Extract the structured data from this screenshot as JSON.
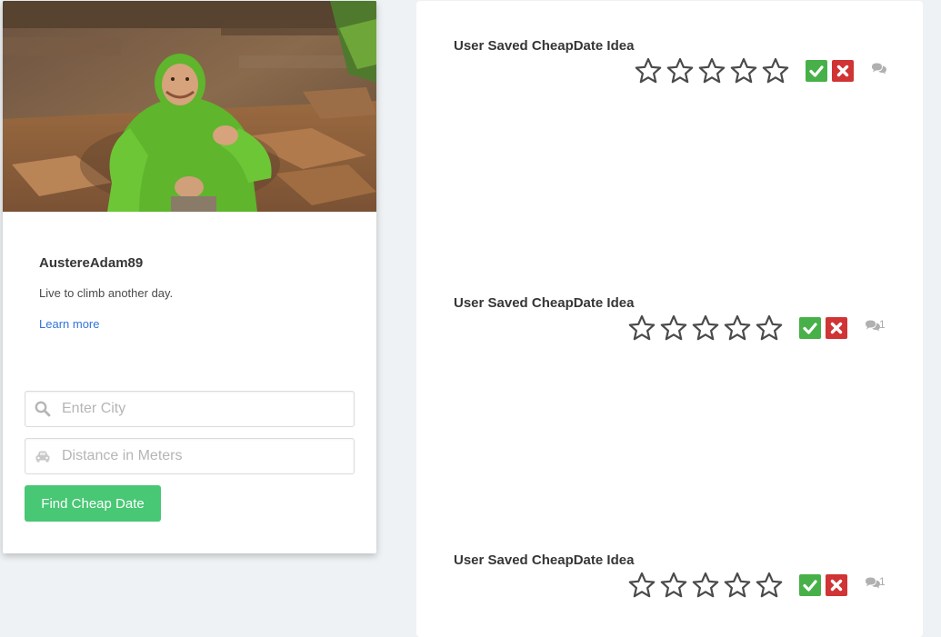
{
  "profile": {
    "username": "AustereAdam89",
    "bio": "Live to climb another day.",
    "learn_more": "Learn more"
  },
  "search": {
    "city_placeholder": "Enter City",
    "city_value": "",
    "distance_placeholder": "Distance in Meters",
    "distance_value": "",
    "submit_label": "Find Cheap Date"
  },
  "ideas": [
    {
      "title": "User Saved CheapDate Idea",
      "rating": 0,
      "comment_count": ""
    },
    {
      "title": "User Saved CheapDate Idea",
      "rating": 0,
      "comment_count": "1"
    },
    {
      "title": "User Saved CheapDate Idea",
      "rating": 0,
      "comment_count": "1"
    }
  ],
  "colors": {
    "accept": "#48b048",
    "reject": "#d03434",
    "submit": "#48c774",
    "link": "#3273dc"
  },
  "icons": {
    "city_field": "search-icon",
    "distance_field": "car-icon",
    "accept": "check-icon",
    "reject": "close-icon",
    "comments": "comments-icon",
    "rating": "star-outline-icon"
  }
}
